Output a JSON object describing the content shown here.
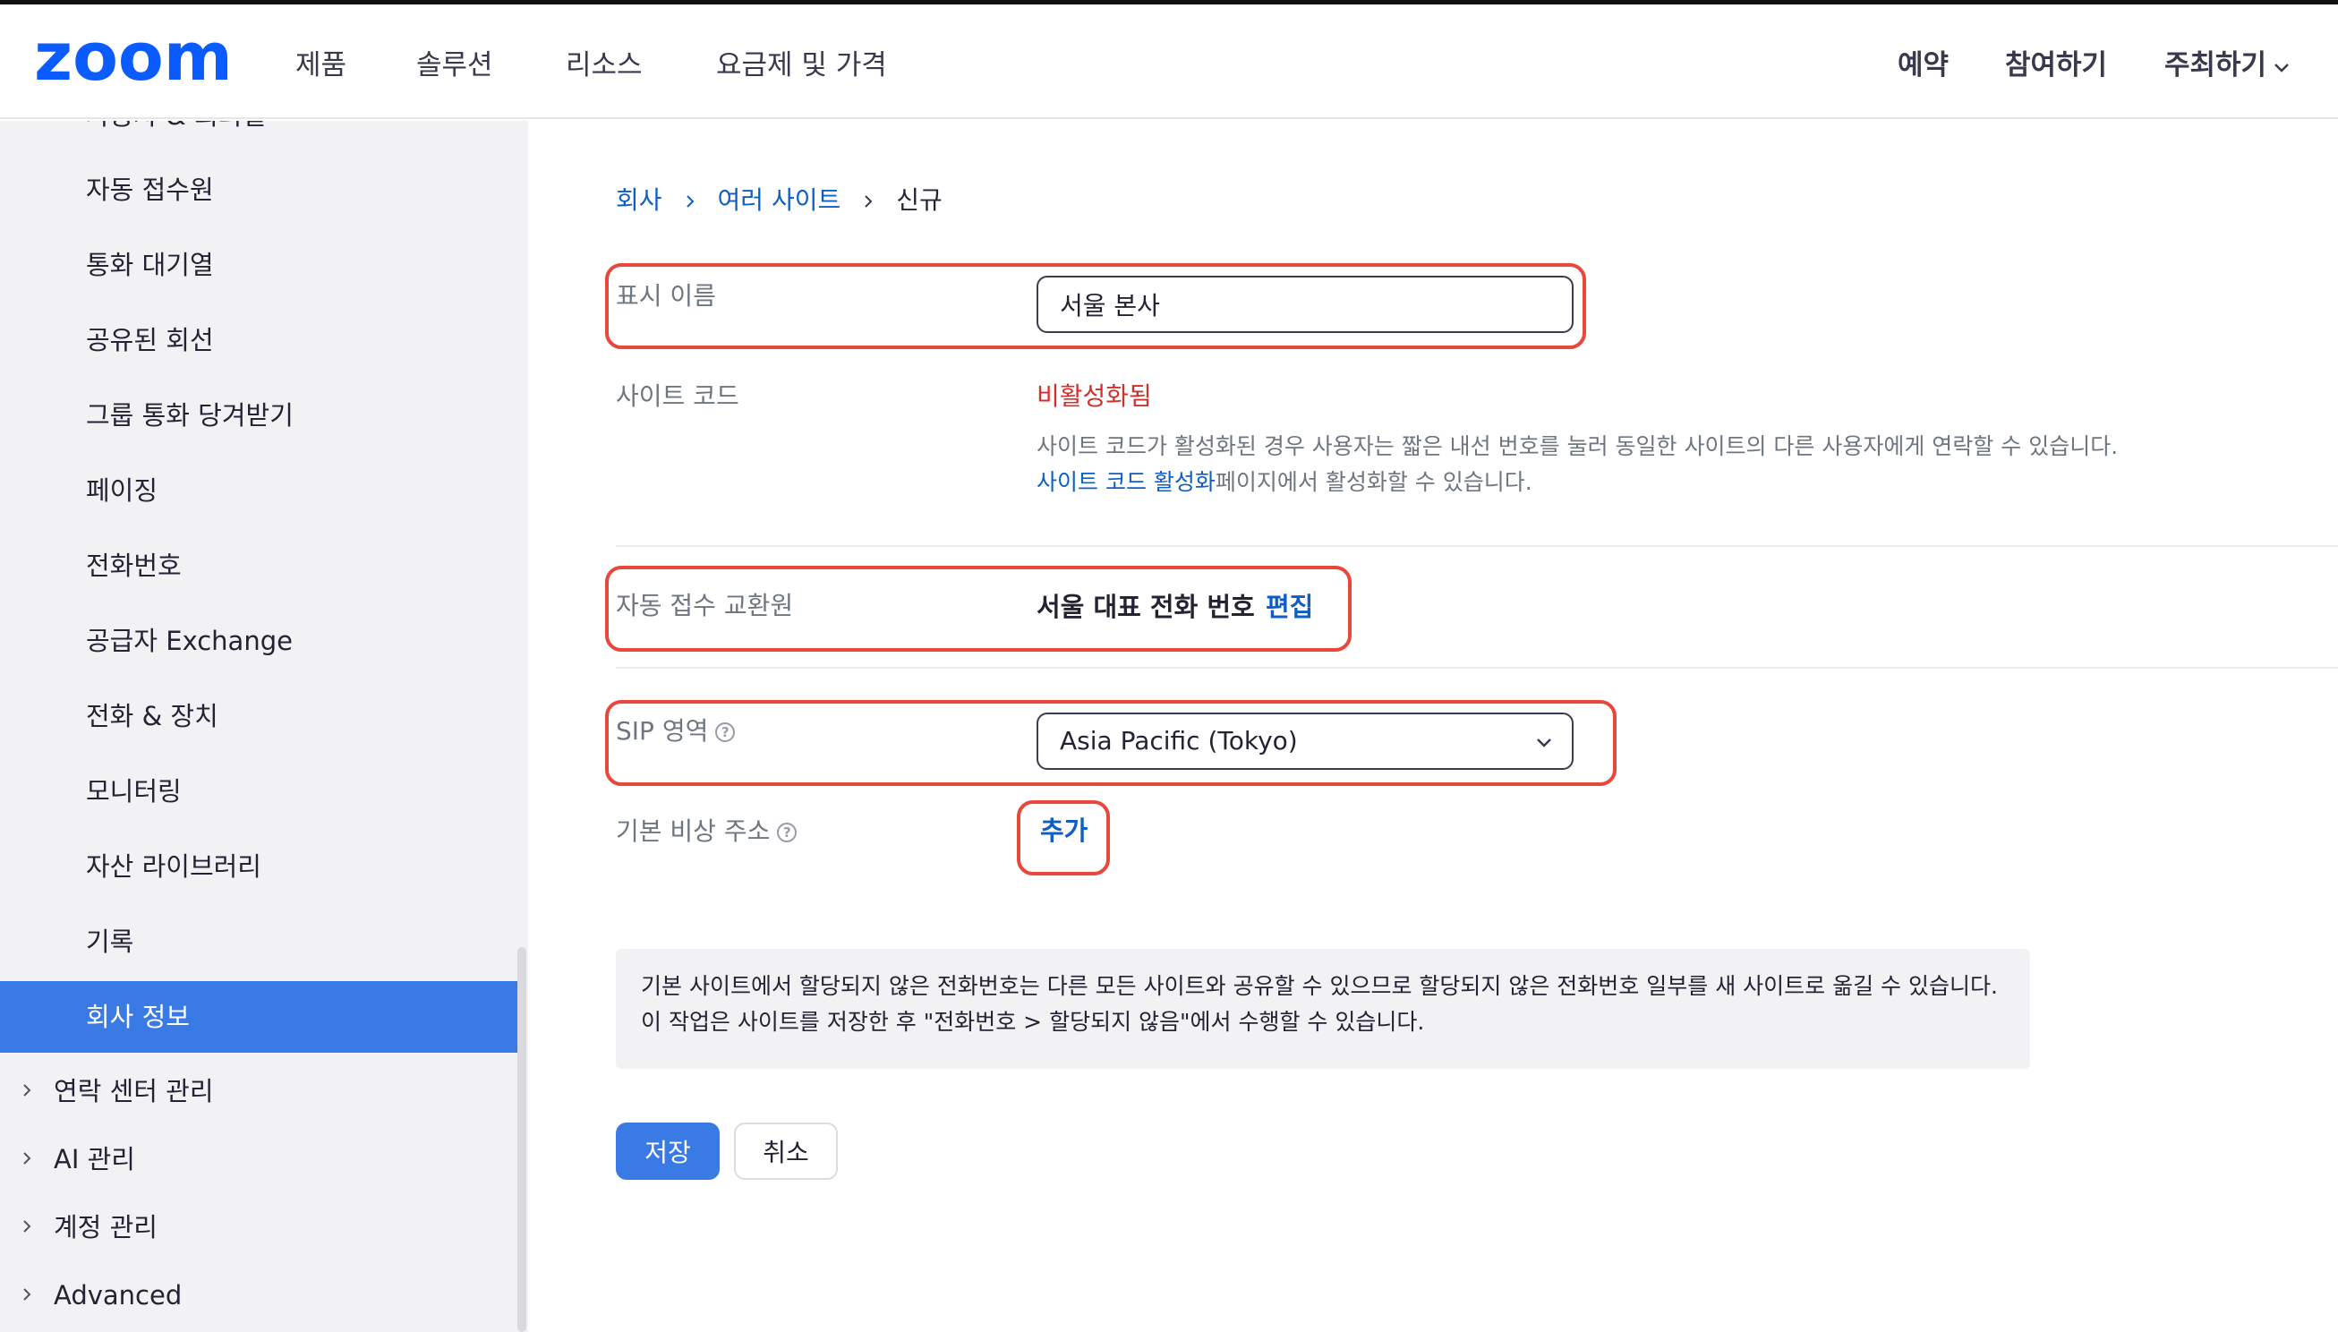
{
  "nav": {
    "logo_text": "zoom",
    "items": [
      "제품",
      "솔루션",
      "리소스",
      "요금제 및 가격"
    ],
    "right": [
      "예약",
      "참여하기",
      "주최하기"
    ]
  },
  "sidebar": {
    "cut_item": "사용자 & 회의실",
    "items": [
      "자동 접수원",
      "통화 대기열",
      "공유된 회선",
      "그룹 통화 당겨받기",
      "페이징",
      "전화번호",
      "공급자 Exchange",
      "전화 & 장치",
      "모니터링",
      "자산 라이브러리",
      "기록",
      "회사 정보"
    ],
    "active_index": 11,
    "groups": [
      "연락 센터 관리",
      "AI 관리",
      "계정 관리",
      "Advanced"
    ]
  },
  "breadcrumb": {
    "items": [
      "회사",
      "여러 사이트"
    ],
    "current": "신규"
  },
  "form": {
    "display_name_label": "표시 이름",
    "display_name_value": "서울 본사",
    "site_code_label": "사이트 코드",
    "site_code_status": "비활성화됨",
    "site_code_help_1": "사이트 코드가 활성화된 경우 사용자는 짧은 내선 번호를 눌러 동일한 사이트의 다른 사용자에게 연락할 수 있습니다. ",
    "site_code_help_link": "사이트 코드 활성화",
    "site_code_help_2": "페이지에서 활성화할 수 있습니다.",
    "auto_receptionist_label": "자동 접수 교환원",
    "auto_receptionist_value": "서울 대표 전화 번호",
    "edit_label": "편집",
    "sip_zone_label": "SIP 영역",
    "sip_zone_value": "Asia Pacific (Tokyo)",
    "emergency_address_label": "기본 비상 주소",
    "add_label": "추가",
    "help_symbol": "?"
  },
  "info_text": "기본 사이트에서 할당되지 않은 전화번호는 다른 모든 사이트와 공유할 수 있으므로 할당되지 않은 전화번호 일부를 새 사이트로 옮길 수 있습니다. 이 작업은 사이트를 저장한 후 \"전화번호 > 할당되지 않음\"에서 수행할 수 있습니다.",
  "buttons": {
    "save": "저장",
    "cancel": "취소"
  },
  "colors": {
    "brand": "#0b5cff",
    "accent": "#3a7ae4",
    "link": "#0e5fc4",
    "error": "#d4302b",
    "highlight": "#e8473c"
  }
}
